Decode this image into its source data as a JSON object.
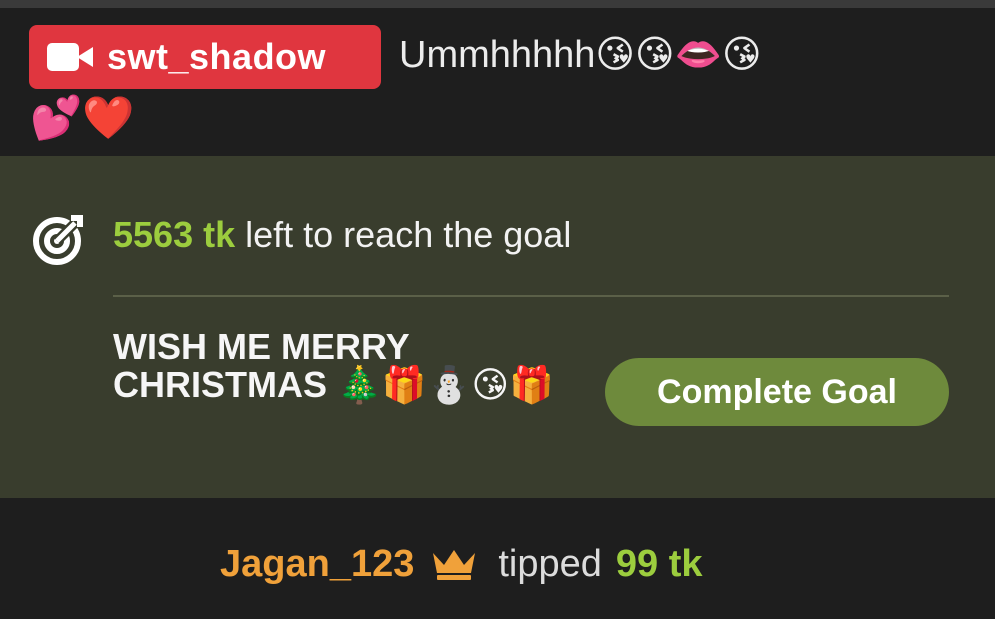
{
  "chat_message": {
    "username": "swt_shadow",
    "text": "Ummhhhhh😘😘👄😘",
    "emoji_line2": "💕❤️",
    "badge_icon": "video-camera-icon",
    "badge_color": "#e0363f"
  },
  "goal": {
    "icon": "target-arrow-icon",
    "amount": "5563 tk",
    "status_text": " left to reach the goal",
    "title": "WISH ME MERRY CHRISTMAS",
    "title_emojis": " 🎄🎁⛄😘🎁",
    "complete_button_label": "Complete Goal",
    "accent_color": "#9ccd3e",
    "panel_color": "#393d2d"
  },
  "tip": {
    "username": "Jagan_123",
    "icon": "crown-icon",
    "verb": "tipped",
    "amount": "99 tk",
    "username_color": "#f0a13a"
  }
}
